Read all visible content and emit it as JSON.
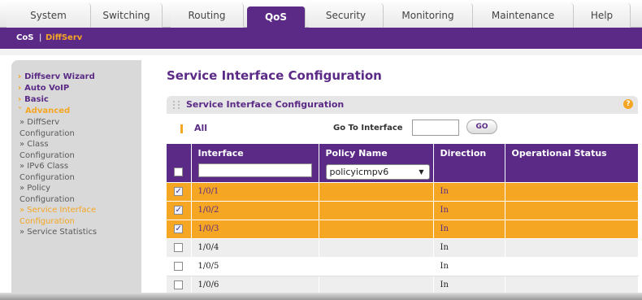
{
  "tabs": [
    "System",
    "Switching",
    "Routing",
    "QoS",
    "Security",
    "Monitoring",
    "Maintenance",
    "Help"
  ],
  "subnav": {
    "cos": "CoS",
    "separator": "|",
    "diffserv": "DiffServ"
  },
  "sidebar": {
    "top_items": [
      "Diffserv Wizard",
      "Auto VoIP",
      "Basic"
    ],
    "advanced": "Advanced",
    "sub_items": [
      [
        "» DiffServ",
        "Configuration"
      ],
      [
        "» Class",
        "Configuration"
      ],
      [
        "» IPv6 Class",
        "Configuration"
      ],
      [
        "» Policy",
        "Configuration"
      ],
      [
        "» Service Interface",
        "Configuration"
      ],
      [
        "» Service Statistics"
      ]
    ]
  },
  "main": {
    "title": "Service Interface Configuration",
    "panel_title": "Service Interface Configuration",
    "help": "?",
    "all_label": "All",
    "goto_label": "Go To Interface",
    "go_button": "GO"
  },
  "table": {
    "headers": [
      "Interface",
      "Policy Name",
      "Direction",
      "Operational Status"
    ],
    "edit_row": {
      "policy": "policyicmpv6"
    },
    "rows": [
      {
        "iface": "1/0/1",
        "dir": "In",
        "checked": true
      },
      {
        "iface": "1/0/2",
        "dir": "In",
        "checked": true
      },
      {
        "iface": "1/0/3",
        "dir": "In",
        "checked": true
      },
      {
        "iface": "1/0/4",
        "dir": "In",
        "checked": false
      },
      {
        "iface": "1/0/5",
        "dir": "In",
        "checked": false
      },
      {
        "iface": "1/0/6",
        "dir": "In",
        "checked": false
      }
    ]
  },
  "colors": {
    "purple": "#5b2a86",
    "orange": "#f5a623"
  }
}
